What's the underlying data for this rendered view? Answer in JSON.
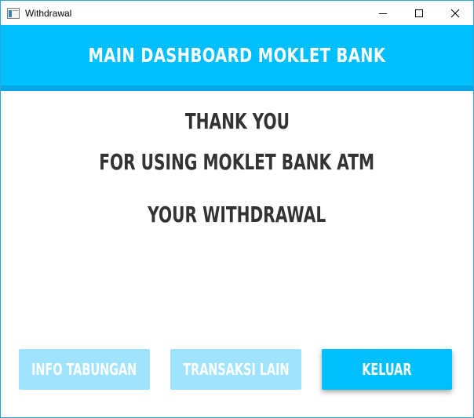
{
  "window": {
    "title": "Withdrawal",
    "controls": [
      "minimize-icon",
      "maximize-icon",
      "close-icon"
    ]
  },
  "header": {
    "title": "MAIN DASHBOARD MOKLET BANK",
    "color": "#00BFFF",
    "stripe_color": "#06A6E6"
  },
  "messages": {
    "line1": "THANK YOU",
    "line2": "FOR USING MOKLET BANK ATM",
    "line3": "YOUR WITHDRAWAL"
  },
  "buttons": {
    "info_tabungan": "INFO TABUNGAN",
    "transaksi_lain": "TRANSAKSI LAIN",
    "keluar": "KELUAR"
  },
  "colors": {
    "button_disabled": "#9FE3FF",
    "button_active": "#00BFFF",
    "text_dark": "#333333"
  }
}
